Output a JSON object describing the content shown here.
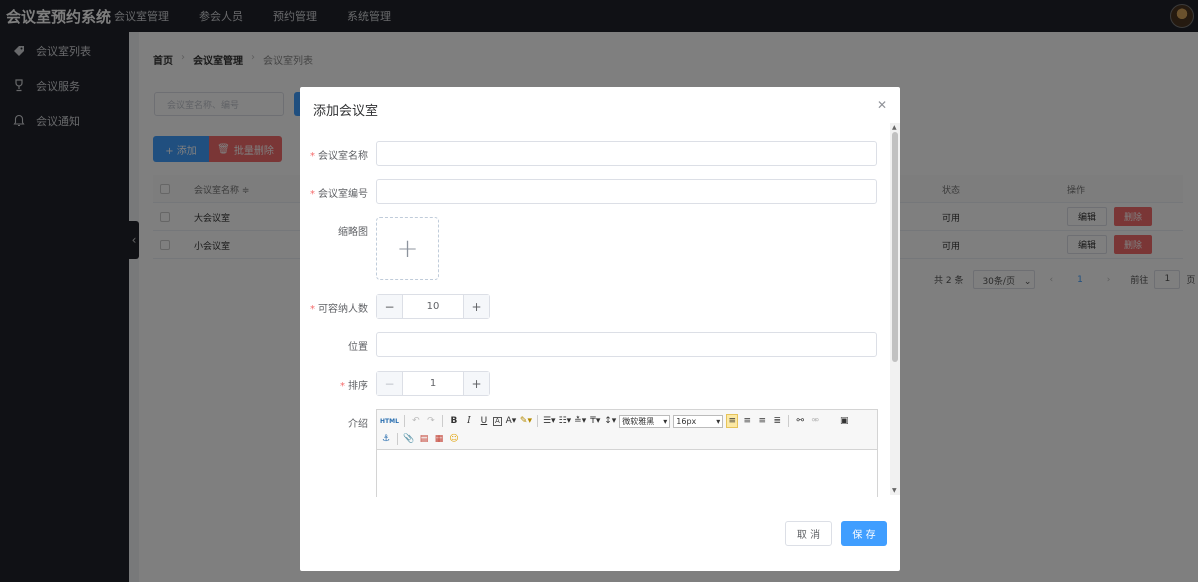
{
  "app": {
    "title": "会议室预约系统"
  },
  "topnav": [
    "会议室管理",
    "参会人员",
    "预约管理",
    "系统管理"
  ],
  "sidebar": {
    "items": [
      {
        "label": "会议室列表",
        "icon": "tag-icon"
      },
      {
        "label": "会议服务",
        "icon": "trophy-icon"
      },
      {
        "label": "会议通知",
        "icon": "bell-icon"
      }
    ]
  },
  "breadcrumb": {
    "home": "首页",
    "section": "会议室管理",
    "current": "会议室列表"
  },
  "search": {
    "placeholder": "会议室名称、编号"
  },
  "actions": {
    "add_label": "+ 添加",
    "batch_delete_label": "批量删除"
  },
  "table": {
    "headers": {
      "name": "会议室名称 ≑",
      "status": "状态",
      "ops": "操作"
    },
    "rows": [
      {
        "name": "大会议室",
        "status": "可用",
        "edit": "编辑",
        "delete": "删除"
      },
      {
        "name": "小会议室",
        "status": "可用",
        "edit": "编辑",
        "delete": "删除"
      }
    ]
  },
  "pagination": {
    "total": "共 2 条",
    "page_size": "30条/页",
    "current_page": "1",
    "goto_prefix": "前往",
    "goto_value": "1",
    "goto_suffix": "页"
  },
  "dialog": {
    "title": "添加会议室",
    "fields": {
      "name": {
        "label": "会议室名称",
        "value": ""
      },
      "code": {
        "label": "会议室编号",
        "value": ""
      },
      "thumbnail": {
        "label": "缩略图"
      },
      "capacity": {
        "label": "可容纳人数",
        "value": "10"
      },
      "location": {
        "label": "位置",
        "value": ""
      },
      "order": {
        "label": "排序",
        "value": "1"
      },
      "intro": {
        "label": "介绍"
      }
    },
    "editor": {
      "font_family": "微软雅黑",
      "font_size": "16px"
    },
    "cancel_label": "取 消",
    "save_label": "保 存"
  },
  "colors": {
    "primary": "#409eff",
    "danger": "#f56c6c",
    "dark": "#20222a"
  }
}
